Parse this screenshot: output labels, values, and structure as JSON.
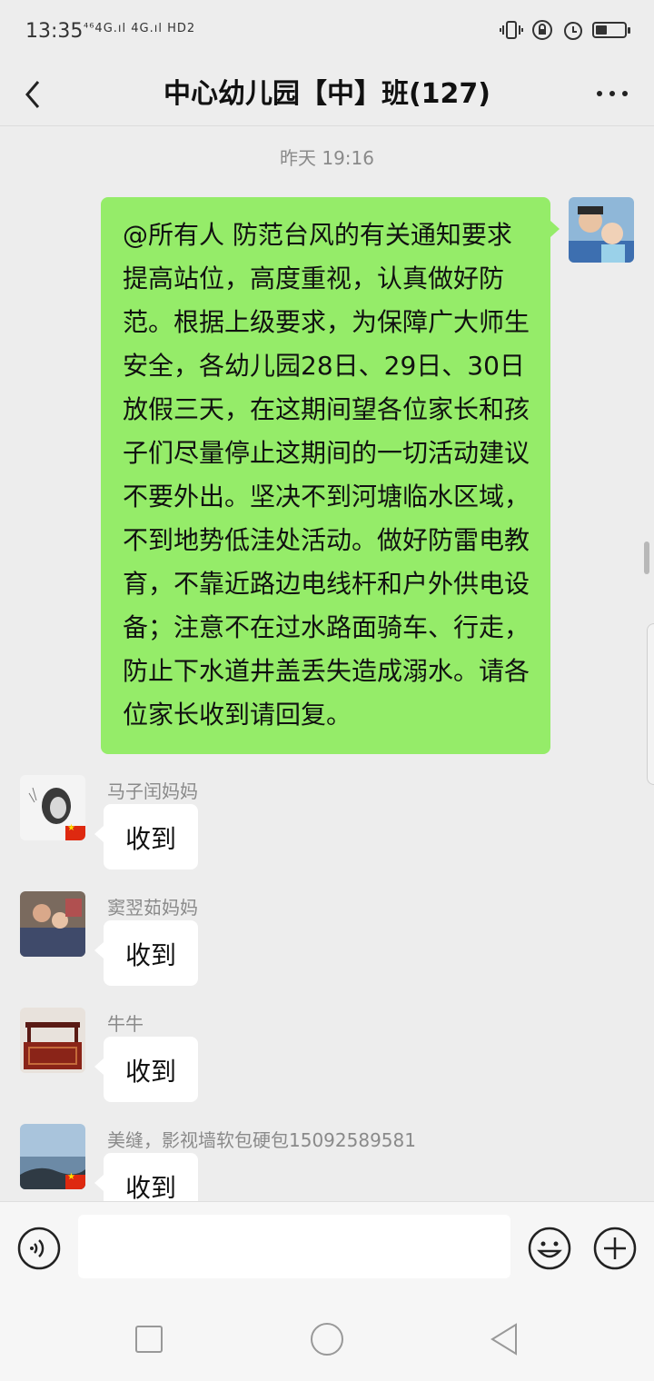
{
  "status_bar": {
    "time": "13:35",
    "network": "⁴⁶4G.ıl 4G.ıl HD2",
    "battery_level": 0.4
  },
  "header": {
    "title": "中心幼儿园【中】班(127)"
  },
  "chat": {
    "timestamp": "昨天 19:16",
    "sent_message": "@所有人 防范台风的有关通知要求提高站位，高度重视，认真做好防范。根据上级要求，为保障广大师生安全，各幼儿园28日、29日、30日放假三天，在这期间望各位家长和孩子们尽量停止这期间的一切活动建议不要外出。坚决不到河塘临水区域，不到地势低洼处活动。做好防雷电教育，不靠近路边电线杆和户外供电设备；注意不在过水路面骑车、行走，防止下水道井盖丢失造成溺水。请各位家长收到请回复。",
    "replies": [
      {
        "sender": "马子闰妈妈",
        "text": "收到"
      },
      {
        "sender": "窦翌茹妈妈",
        "text": "收到"
      },
      {
        "sender": "牛牛",
        "text": "收到"
      },
      {
        "sender": "美缝，影视墙软包硬包15092589581",
        "text": "收到"
      }
    ]
  },
  "colors": {
    "sent_bubble": "#95ec69",
    "received_bubble": "#ffffff",
    "background": "#ededed"
  }
}
